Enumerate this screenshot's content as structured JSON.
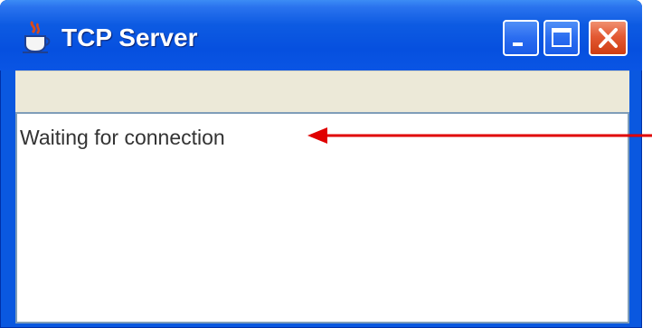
{
  "window": {
    "title": "TCP Server",
    "title_icon": "java-coffee-cup-icon",
    "controls": {
      "minimize_icon": "minimize-icon",
      "maximize_icon": "maximize-icon",
      "close_icon": "close-icon"
    }
  },
  "content": {
    "status": "Waiting for connection"
  },
  "colors": {
    "title_bar": "#0650df",
    "close_button": "#e35a34",
    "annotation_arrow": "#e00000",
    "toolbar": "#ece9d8"
  }
}
